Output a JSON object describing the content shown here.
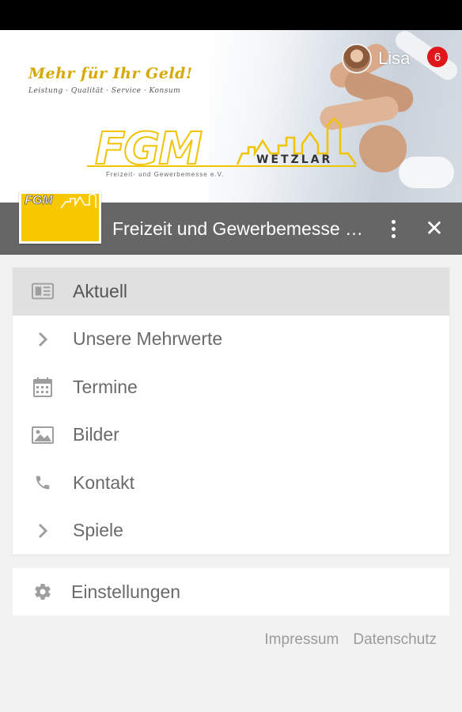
{
  "banner": {
    "slogan": "Mehr für Ihr Geld!",
    "slogan_sub": "Leistung · Qualität · Service · Konsum",
    "logo_text": "FGM",
    "logo_city": "WETZLAR",
    "logo_tagline": "Freizeit- und Gewerbemesse e.V."
  },
  "user": {
    "name": "Lisa",
    "notifications": "6"
  },
  "app_bar": {
    "logo_text": "FGM",
    "title": "Freizeit und Gewerbemesse Wetzlar",
    "more_icon": "more-vert-icon",
    "close_glyph": "✕"
  },
  "menu": {
    "items": [
      {
        "label": "Aktuell",
        "icon": "newspaper-icon",
        "active": true
      },
      {
        "label": "Unsere Mehrwerte",
        "icon": "chevron-right-icon"
      },
      {
        "label": "Termine",
        "icon": "calendar-icon"
      },
      {
        "label": "Bilder",
        "icon": "image-icon"
      },
      {
        "label": "Kontakt",
        "icon": "phone-icon"
      },
      {
        "label": "Spiele",
        "icon": "chevron-right-icon"
      }
    ]
  },
  "settings": {
    "label": "Einstellungen",
    "icon": "gear-icon"
  },
  "footer": {
    "impressum": "Impressum",
    "datenschutz": "Datenschutz"
  },
  "colors": {
    "accent": "#f7c800",
    "app_bar": "#666666",
    "badge": "#e1161c",
    "icon": "#9e9e9e"
  }
}
